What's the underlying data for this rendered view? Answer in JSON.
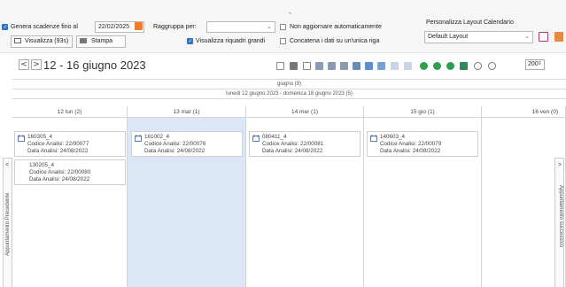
{
  "toolbar": {
    "genera_label": "Genera scadenze fino al",
    "genera_date": "22/02/2025",
    "visualizza_btn": "Visualizza (93s)",
    "stampa_btn": "Stampa",
    "raggruppa_label": "Raggruppa per:",
    "raggruppa_value": "",
    "visualizza_riquadri": "Visualizza riquadri grandi",
    "non_aggiornare": "Non aggiornare automaticamente",
    "concatena": "Concatena i dati su un'unica riga",
    "layout_label": "Personalizza Layout Calendario",
    "layout_value": "Default Layout"
  },
  "nav": {
    "prev": "<",
    "next": ">",
    "title": "12 - 16 giugno 2023",
    "zoom": "200"
  },
  "calendar": {
    "month_header": "giugno (9)",
    "week_header": "lunedì 12 giugno 2023 - domenica 18 giugno 2023 (5)",
    "days": [
      {
        "label": "12 lun (2)"
      },
      {
        "label": "13 mar (1)"
      },
      {
        "label": "14 mer (1)"
      },
      {
        "label": "15 gio (1)"
      },
      {
        "label": "16 ven (0)"
      }
    ],
    "appointments": [
      {
        "title": "160305_4",
        "codice": "Codice Analisi: 22/00077",
        "data": "Data Analisi: 24/08/2022"
      },
      {
        "title": "130205_4",
        "codice": "Codice Analisi: 22/00080",
        "data": "Data Analisi: 24/08/2022"
      },
      {
        "title": "161002_4",
        "codice": "Codice Analisi: 22/00076",
        "data": "Data Analisi: 24/08/2022"
      },
      {
        "title": "080411_4",
        "codice": "Codice Analisi: 22/00081",
        "data": "Data Analisi: 24/08/2022"
      },
      {
        "title": "140603_4",
        "codice": "Codice Analisi: 22/00079",
        "data": "Data Analisi: 24/08/2022"
      }
    ],
    "prev_appt_label": "Appuntamento Precedente",
    "next_appt_label": "Appuntamento successivo",
    "prev_arrow": "<",
    "next_arrow": ">"
  },
  "colors": {
    "accent": "#2f74c9",
    "selected_day": "#dbe7f6"
  }
}
